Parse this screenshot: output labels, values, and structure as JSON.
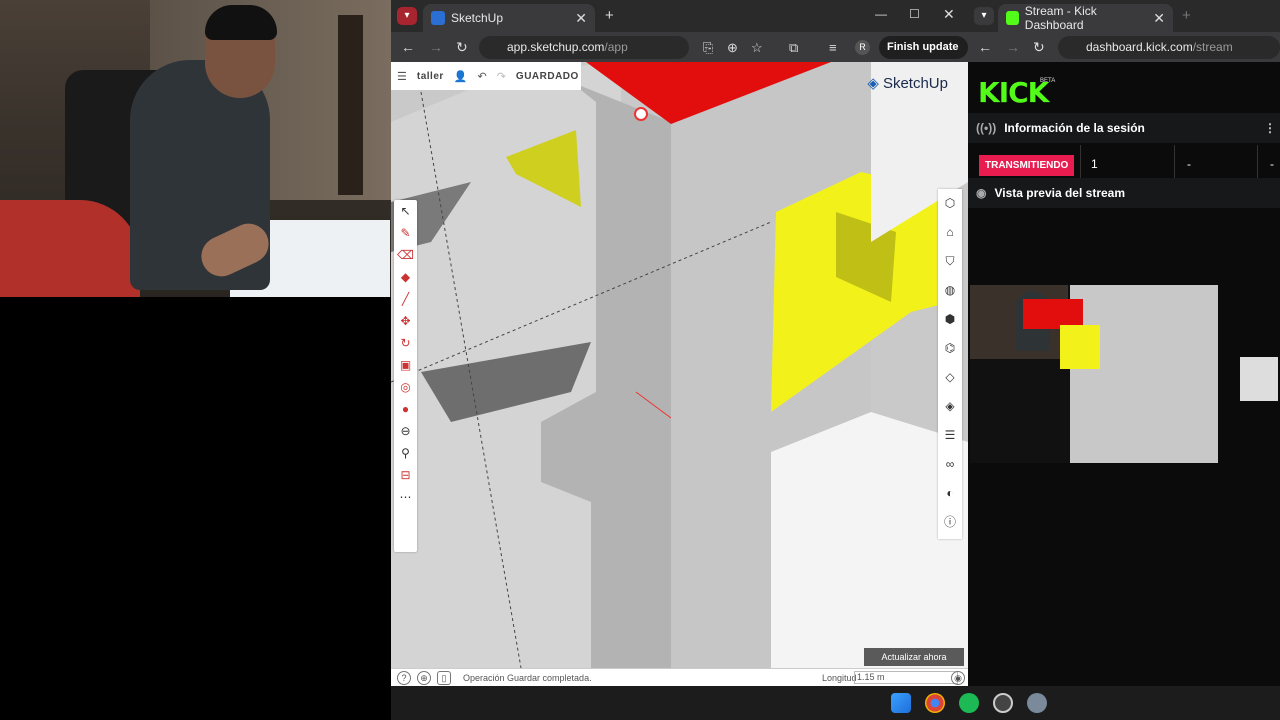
{
  "browser1": {
    "tab_title": "SketchUp",
    "url_host": "app.sketchup.com",
    "url_path": "/app",
    "finish_update": "Finish update",
    "profile_initial": "R"
  },
  "sketchup": {
    "file_name": "taller",
    "save_status": "GUARDADO",
    "brand": "SketchUp",
    "update_now": "Actualizar ahora",
    "status_message": "Operación Guardar completada.",
    "length_label": "Longitud",
    "length_value": "1.15 m",
    "colors": {
      "accent_red": "#e20d0d",
      "accent_yellow": "#f2f21a",
      "tool_red": "#cc3333"
    }
  },
  "browser2": {
    "tab_title": "Stream - Kick Dashboard",
    "url_host": "dashboard.kick.com",
    "url_path": "/stream",
    "brand": "KICK",
    "beta": "BETA",
    "session_header": "Información de la sesión",
    "live_badge": "TRANSMITIENDO",
    "viewers": "1",
    "stat2": "-",
    "stat3": "-",
    "preview_header": "Vista previa del stream",
    "colors": {
      "kick_green": "#53fc18",
      "live_red": "#e81c4f"
    }
  }
}
